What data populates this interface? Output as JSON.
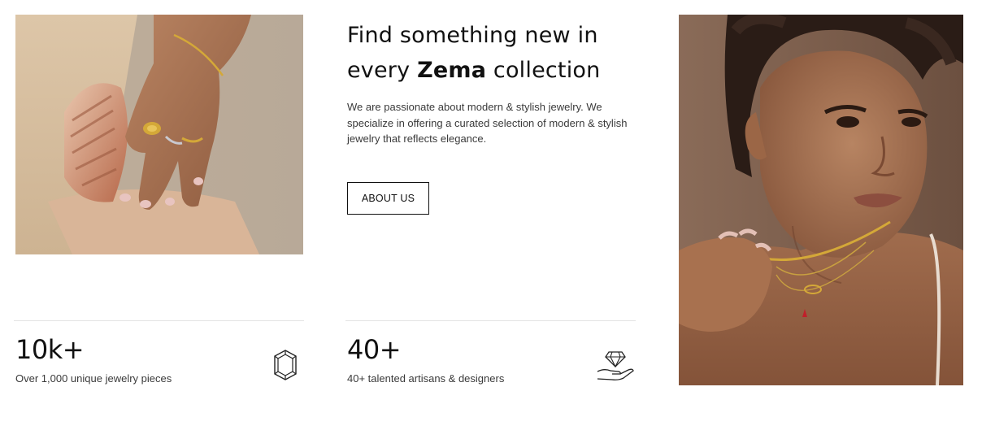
{
  "hero": {
    "headline_part1": "Find something new in every ",
    "headline_brand": "Zema",
    "headline_part2": " collection",
    "intro": "We are passionate about modern & stylish jewelry. We specialize in offering a curated selection of modern & stylish jewelry that reflects elegance.",
    "about_button_label": "ABOUT US"
  },
  "stats": [
    {
      "value": "10k+",
      "description": "Over 1,000 unique jewelry pieces",
      "icon": "gemstone-icon"
    },
    {
      "value": "40+",
      "description": "40+ talented artisans & designers",
      "icon": "hand-diamond-icon"
    }
  ],
  "images": {
    "left": "hand-with-rings-and-seashell-photo",
    "right": "woman-with-necklace-portrait-photo"
  },
  "colors": {
    "text": "#111111",
    "body_text": "#3a3a3a",
    "divider": "#e4e4e4",
    "background": "#ffffff"
  }
}
